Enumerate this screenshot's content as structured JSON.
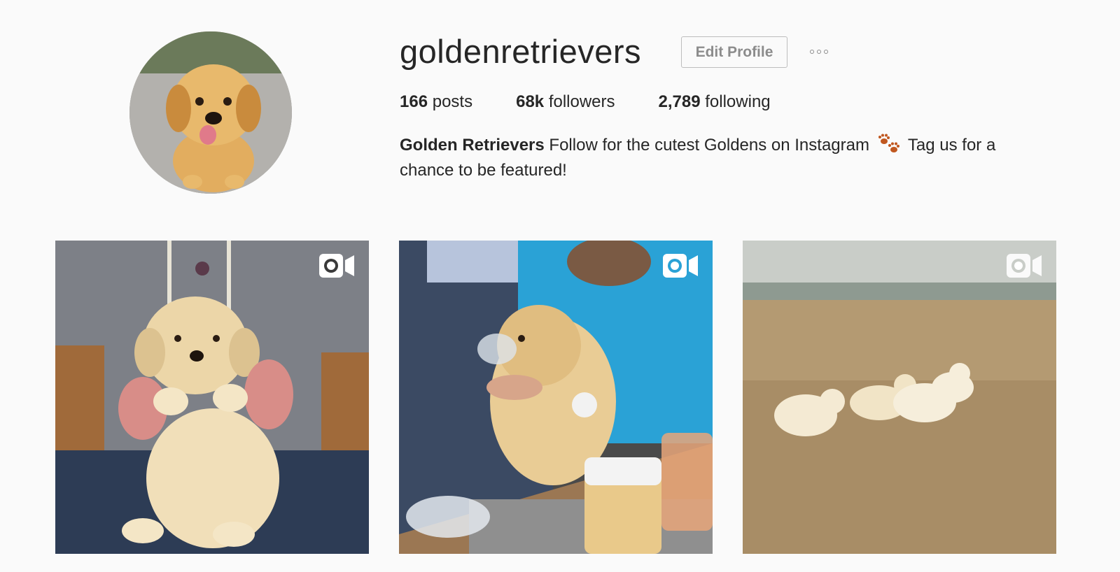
{
  "profile": {
    "username": "goldenretrievers",
    "edit_profile_label": "Edit Profile",
    "stats": {
      "posts_count": "166",
      "posts_label": "posts",
      "followers_count": "68k",
      "followers_label": "followers",
      "following_count": "2,789",
      "following_label": "following"
    },
    "bio": {
      "name": "Golden Retrievers",
      "text_before_emoji": " Follow for the cutest Goldens on Instagram ",
      "emoji": "paw-prints-icon",
      "text_after_emoji": " Tag us for a chance to be featured!"
    }
  },
  "posts": [
    {
      "type": "video",
      "icon": "video-camera-icon"
    },
    {
      "type": "video",
      "icon": "video-camera-icon"
    },
    {
      "type": "video",
      "icon": "video-camera-icon"
    }
  ],
  "colors": {
    "background": "#fafafa",
    "text": "#262626",
    "button_text": "#8c8c8c",
    "button_border": "#bdbdbd"
  }
}
